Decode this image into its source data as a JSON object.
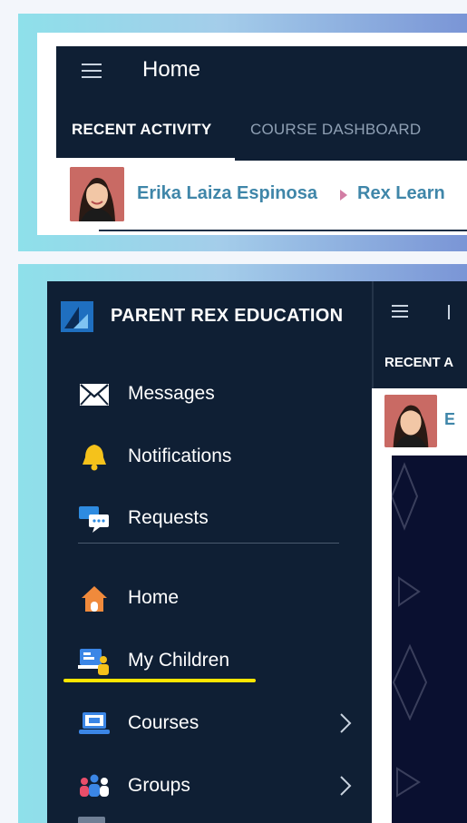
{
  "top": {
    "app_title": "Home",
    "tabs": [
      {
        "label": "RECENT ACTIVITY",
        "active": true
      },
      {
        "label": "COURSE DASHBOARD",
        "active": false
      }
    ],
    "feed": {
      "author": "Erika Laiza Espinosa",
      "course": "Rex Learn"
    }
  },
  "bottom": {
    "drawer_title": "PARENT REX EDUCATION",
    "behind_tab": "RECENT A",
    "behind_feed_initial": "E",
    "items": [
      {
        "label": "Messages",
        "icon": "envelope-icon"
      },
      {
        "label": "Notifications",
        "icon": "bell-icon"
      },
      {
        "label": "Requests",
        "icon": "chat-bubbles-icon"
      },
      {
        "label": "Home",
        "icon": "house-icon"
      },
      {
        "label": "My Children",
        "icon": "children-icon"
      },
      {
        "label": "Courses",
        "icon": "laptop-icon"
      },
      {
        "label": "Groups",
        "icon": "people-icon"
      }
    ]
  },
  "colors": {
    "app_bar": "#0f1f34",
    "highlight": "#ffe600",
    "link": "#3f86a9",
    "breadcrumb_arrow": "#d27da4"
  }
}
